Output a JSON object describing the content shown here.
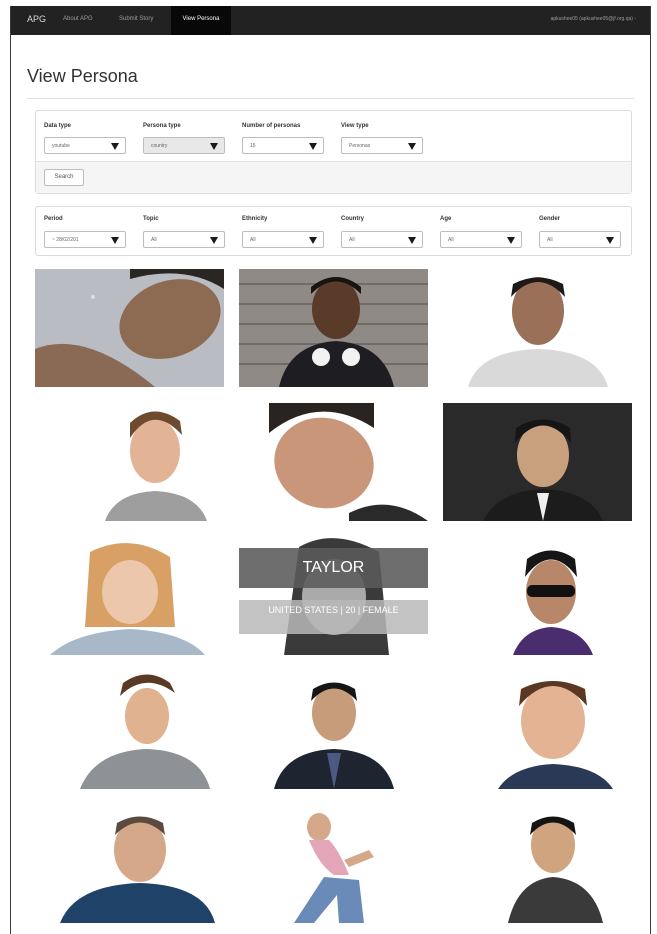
{
  "nav": {
    "brand": "APG",
    "links": [
      "About APG",
      "Submit Story",
      "View Persona"
    ],
    "user": "apkushee05 (apkushee05@jf.org.qa) -"
  },
  "page": {
    "title": "View Persona"
  },
  "filters_top": {
    "data_type": {
      "label": "Data type",
      "value": "youtube"
    },
    "persona_type": {
      "label": "Persona type",
      "value": "country"
    },
    "num_personas": {
      "label": "Number of personas",
      "value": "15"
    },
    "view_type": {
      "label": "View type",
      "value": "Personas"
    },
    "search_label": "Search"
  },
  "filters_bottom": {
    "period": {
      "label": "Period",
      "value": "~ 28/02/201"
    },
    "topic": {
      "label": "Topic",
      "value": "All"
    },
    "ethnicity": {
      "label": "Ethnicity",
      "value": "All"
    },
    "country": {
      "label": "Country",
      "value": "All"
    },
    "age": {
      "label": "Age",
      "value": "All"
    },
    "gender": {
      "label": "Gender",
      "value": "All"
    }
  },
  "hover_persona": {
    "name": "TAYLOR",
    "info": "UNITED STATES | 20 | FEMALE"
  },
  "colors": {
    "navbar": "#222222",
    "active_nav": "#080808"
  }
}
